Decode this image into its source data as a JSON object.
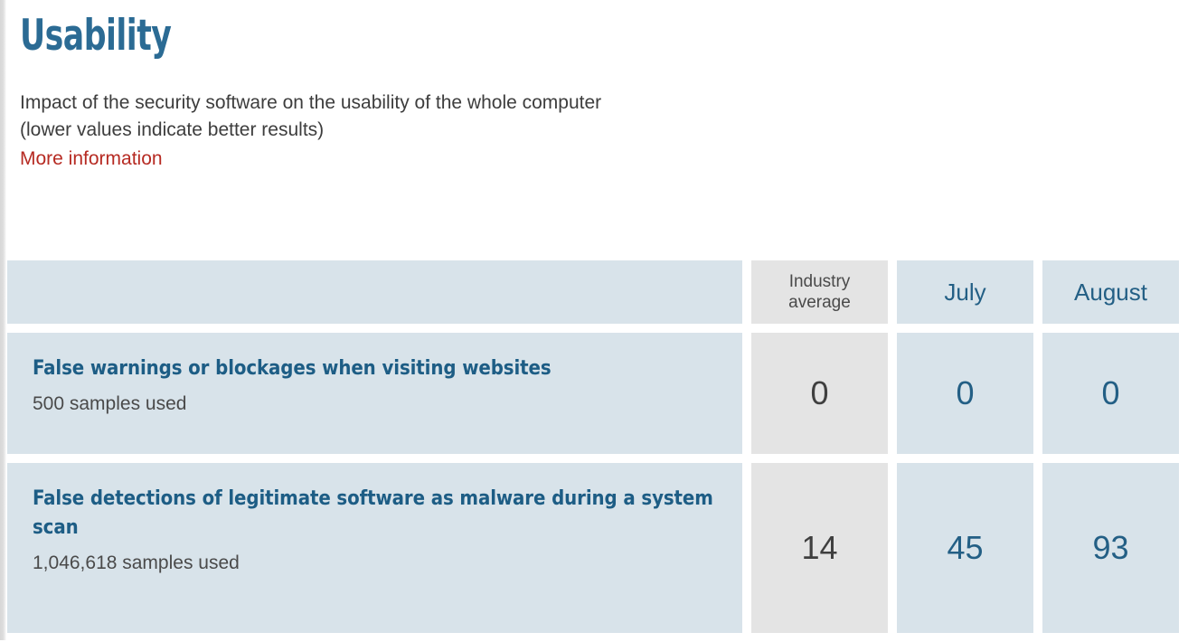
{
  "section": {
    "title": "Usability",
    "description_line_1": "Impact of the security software on the usability of the whole computer",
    "description_line_2": "(lower values indicate better results)",
    "more_information_label": "More information"
  },
  "colors": {
    "heading_blue": "#2b6b94",
    "link_red": "#b62a22",
    "cell_blue_bg": "#d8e3ea",
    "cell_gray_bg": "#e4e4e4",
    "value_blue": "#235f85",
    "value_gray": "#3f3f3f",
    "body_text": "#3d3d3d"
  },
  "table": {
    "header": {
      "label_column": "",
      "industry_average": "Industry\naverage",
      "industry_average_line_1": "Industry",
      "industry_average_line_2": "average",
      "columns": [
        "July",
        "August"
      ]
    },
    "rows": [
      {
        "title": "False warnings or blockages when visiting websites",
        "samples": "500 samples used",
        "industry_average": "0",
        "july": "0",
        "august": "0"
      },
      {
        "title": "False detections of legitimate software as malware during a system scan",
        "samples": "1,046,618 samples used",
        "industry_average": "14",
        "july": "45",
        "august": "93"
      }
    ]
  },
  "chart_data": {
    "type": "table",
    "title": "Usability",
    "categories": [
      "False warnings or blockages when visiting websites",
      "False detections of legitimate software as malware during a system scan"
    ],
    "series": [
      {
        "name": "Industry average",
        "values": [
          0,
          14
        ]
      },
      {
        "name": "July",
        "values": [
          0,
          45
        ]
      },
      {
        "name": "August",
        "values": [
          0,
          93
        ]
      }
    ],
    "annotations": [
      "500 samples used",
      "1,046,618 samples used"
    ],
    "ylabel": "",
    "xlabel": "",
    "legend": "top"
  }
}
